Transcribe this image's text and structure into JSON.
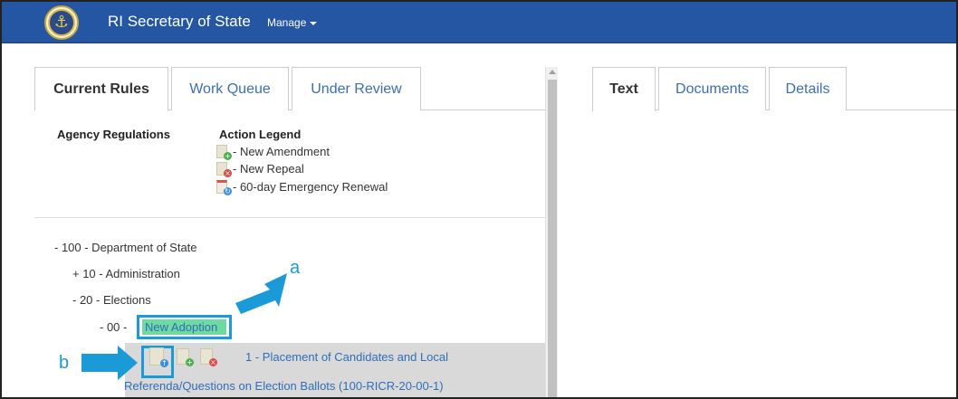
{
  "header": {
    "brand": "RI Secretary of State",
    "manage_label": "Manage"
  },
  "left_tabs": [
    {
      "label": "Current Rules",
      "active": true
    },
    {
      "label": "Work Queue",
      "active": false
    },
    {
      "label": "Under Review",
      "active": false
    }
  ],
  "agency_label": "Agency Regulations",
  "legend": {
    "title": "Action Legend",
    "items": [
      {
        "label": "- New Amendment",
        "icon": "new-amendment-icon"
      },
      {
        "label": "- New Repeal",
        "icon": "new-repeal-icon"
      },
      {
        "label": "- 60-day Emergency Renewal",
        "icon": "emergency-renewal-icon"
      }
    ]
  },
  "tree": {
    "dept": "- 100 - Department of State",
    "admin": "+ 10 - Administration",
    "elections": "- 20 - Elections",
    "sub": "- 00 -",
    "adoption": "New Adoption",
    "rule_line1": "1 - Placement of Candidates and Local",
    "rule_line2": "Referenda/Questions on Election Ballots (100-RICR-20-00-1)"
  },
  "right_tabs": [
    {
      "label": "Text",
      "active": true
    },
    {
      "label": "Documents",
      "active": false
    },
    {
      "label": "Details",
      "active": false
    }
  ],
  "callouts": {
    "a": "a",
    "b": "b"
  },
  "colors": {
    "navbar": "#2456a4",
    "callout": "#1a9ad6",
    "highlight": "#6ed9a0"
  }
}
